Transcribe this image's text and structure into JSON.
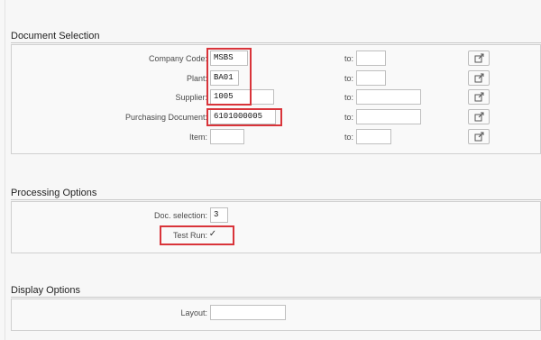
{
  "document_selection": {
    "title": "Document Selection",
    "rows": [
      {
        "label": "Company Code:",
        "value": "MSBS",
        "to_label": "to:",
        "to_value": ""
      },
      {
        "label": "Plant:",
        "value": "BA01",
        "to_label": "to:",
        "to_value": ""
      },
      {
        "label": "Supplier:",
        "value": "1005",
        "to_label": "to:",
        "to_value": ""
      },
      {
        "label": "Purchasing Document:",
        "value": "6101000005",
        "to_label": "to:",
        "to_value": ""
      },
      {
        "label": "Item:",
        "value": "",
        "to_label": "to:",
        "to_value": ""
      }
    ],
    "multiple_selection_icon": "arrow-out-icon"
  },
  "processing_options": {
    "title": "Processing Options",
    "doc_selection_label": "Doc. selection:",
    "doc_selection_value": "3",
    "test_run_label": "Test Run:",
    "test_run_checked": true,
    "test_run_mark": "✓"
  },
  "display_options": {
    "title": "Display Options",
    "layout_label": "Layout:",
    "layout_value": ""
  },
  "colors": {
    "highlight": "#d9343a",
    "panel_border": "#d0d0d0",
    "field_border": "#bfbfbf"
  }
}
